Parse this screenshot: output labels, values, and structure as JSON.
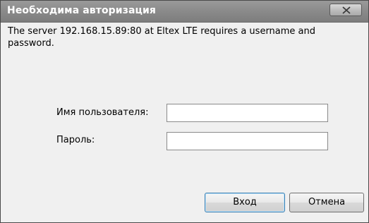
{
  "dialog": {
    "title": "Необходима авторизация",
    "message": "The server 192.168.15.89:80 at Eltex LTE requires a username and password.",
    "username_label": "Имя пользователя:",
    "password_label": "Пароль:",
    "username_value": "",
    "password_value": "",
    "login_button": "Вход",
    "cancel_button": "Отмена"
  },
  "icons": {
    "close": "close-icon"
  },
  "colors": {
    "titlebar": "#8a8a8a",
    "window_bg": "#f0f0f0",
    "title_text": "#ffffff"
  }
}
